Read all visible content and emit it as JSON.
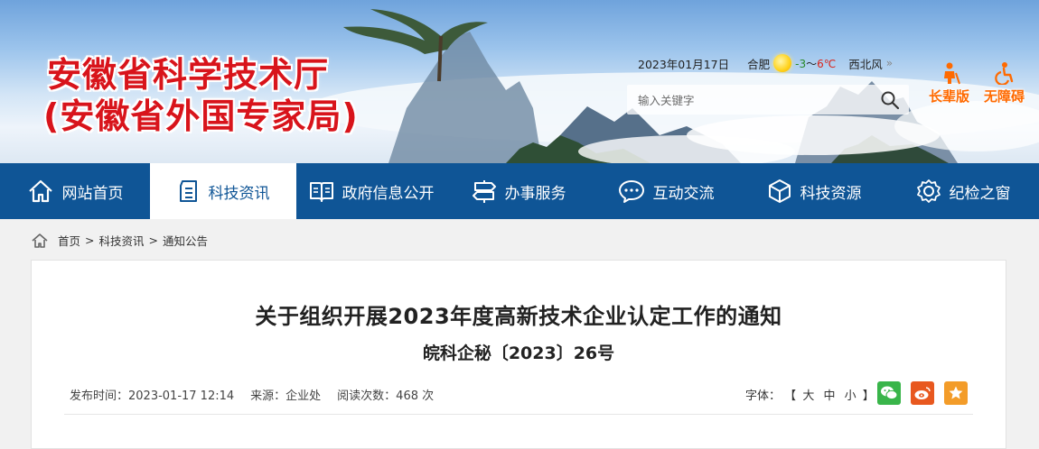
{
  "header": {
    "title_line1": "安徽省科学技术厅",
    "title_line2": "(安徽省外国专家局)",
    "date": "2023年01月17日",
    "weather": {
      "city": "合肥",
      "low": "-3",
      "sep": "～",
      "high": "6℃",
      "wind": "西北风",
      "wind_more": "»"
    },
    "search_placeholder": "输入关键字",
    "modes": [
      {
        "label": "长辈版",
        "icon": "elder-icon"
      },
      {
        "label": "无障碍",
        "icon": "accessibility-icon"
      }
    ]
  },
  "nav": {
    "items": [
      {
        "label": "网站首页",
        "icon": "home-icon"
      },
      {
        "label": "科技资讯",
        "icon": "news-icon",
        "active": true
      },
      {
        "label": "政府信息公开",
        "icon": "book-icon"
      },
      {
        "label": "办事服务",
        "icon": "signpost-icon"
      },
      {
        "label": "互动交流",
        "icon": "chat-icon"
      },
      {
        "label": "科技资源",
        "icon": "cube-icon"
      },
      {
        "label": "纪检之窗",
        "icon": "badge-icon"
      }
    ]
  },
  "breadcrumb": [
    "首页",
    "科技资讯",
    "通知公告"
  ],
  "breadcrumb_sep": ">",
  "article": {
    "title": "关于组织开展2023年度高新技术企业认定工作的通知",
    "doc_number": "皖科企秘〔2023〕26号",
    "publish_time": "发布时间：2023-01-17 12:14",
    "source": "来源：企业处",
    "views": "阅读次数：468 次",
    "font_label": "字体：",
    "font_open": "【",
    "font_options": [
      "大",
      "中",
      "小"
    ],
    "font_close": "】"
  },
  "colors": {
    "nav_bg": "#0f5596",
    "title_red": "#d8141b",
    "mode_orange": "#ff6a00",
    "wechat": "#39b54a",
    "weibo": "#e8581f",
    "favorite": "#f39c29"
  }
}
